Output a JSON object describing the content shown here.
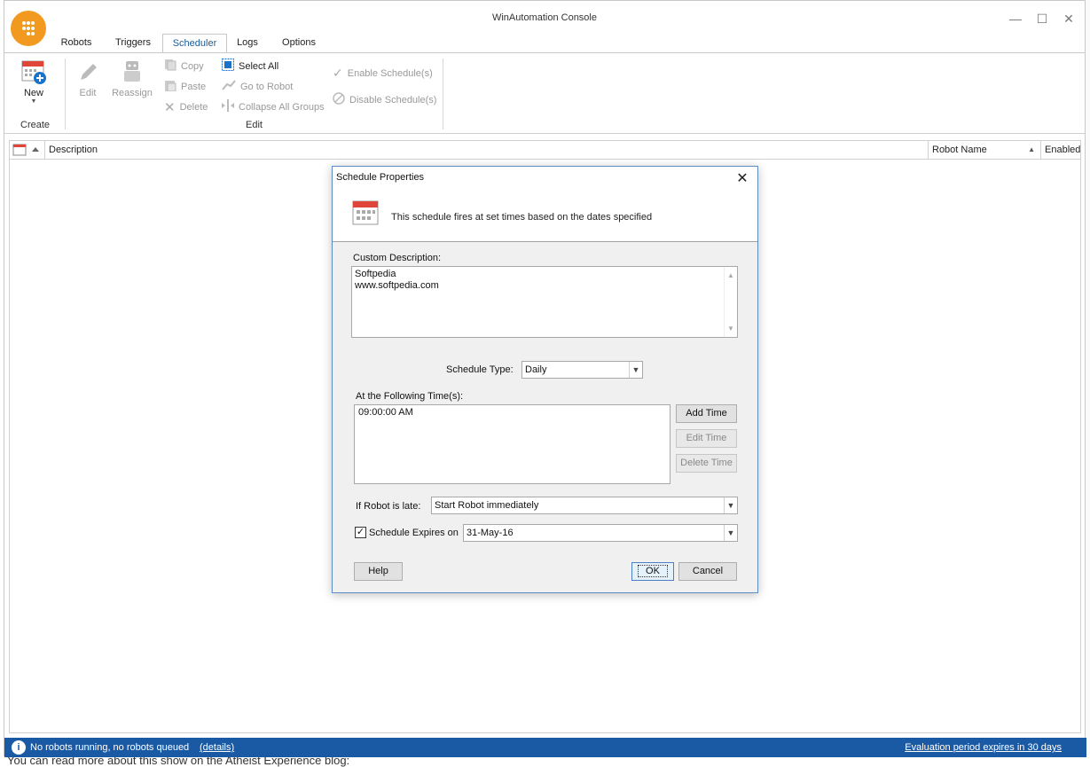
{
  "window": {
    "title": "WinAutomation Console"
  },
  "tabs": [
    "Robots",
    "Triggers",
    "Scheduler",
    "Logs",
    "Options"
  ],
  "active_tab": "Scheduler",
  "ribbon": {
    "new_label": "New",
    "create_group": "Create",
    "edit_label": "Edit",
    "reassign_label": "Reassign",
    "copy_label": "Copy",
    "paste_label": "Paste",
    "delete_label": "Delete",
    "select_all_label": "Select All",
    "go_to_robot_label": "Go to Robot",
    "collapse_label": "Collapse All Groups",
    "edit_group": "Edit",
    "enable_label": "Enable Schedule(s)",
    "disable_label": "Disable Schedule(s)"
  },
  "grid": {
    "columns": [
      "Description",
      "Robot Name",
      "Enabled"
    ]
  },
  "status": {
    "text": "No robots running, no robots queued",
    "details_link": "(details)",
    "evaluation": "Evaluation period expires in 30 days"
  },
  "dialog": {
    "title": "Schedule Properties",
    "subtitle": "This schedule fires at set times based on the dates specified",
    "custom_description_label": "Custom Description:",
    "custom_description_lines": [
      "Softpedia",
      "www.softpedia.com"
    ],
    "schedule_type_label": "Schedule Type:",
    "schedule_type_value": "Daily",
    "times_label": "At the Following Time(s):",
    "times": [
      "09:00:00 AM"
    ],
    "add_time": "Add Time",
    "edit_time": "Edit Time",
    "delete_time": "Delete Time",
    "late_label": "If Robot is late:",
    "late_value": "Start Robot immediately",
    "expires_label": "Schedule Expires on",
    "expires_checked": true,
    "expires_value": "31-May-16",
    "help": "Help",
    "ok": "OK",
    "cancel": "Cancel"
  },
  "background": {
    "blog_text": "You can read more about this show on the Atheist Experience blog:"
  },
  "colors": {
    "accent": "#1a5aa5",
    "logo": "#f29a1f"
  }
}
